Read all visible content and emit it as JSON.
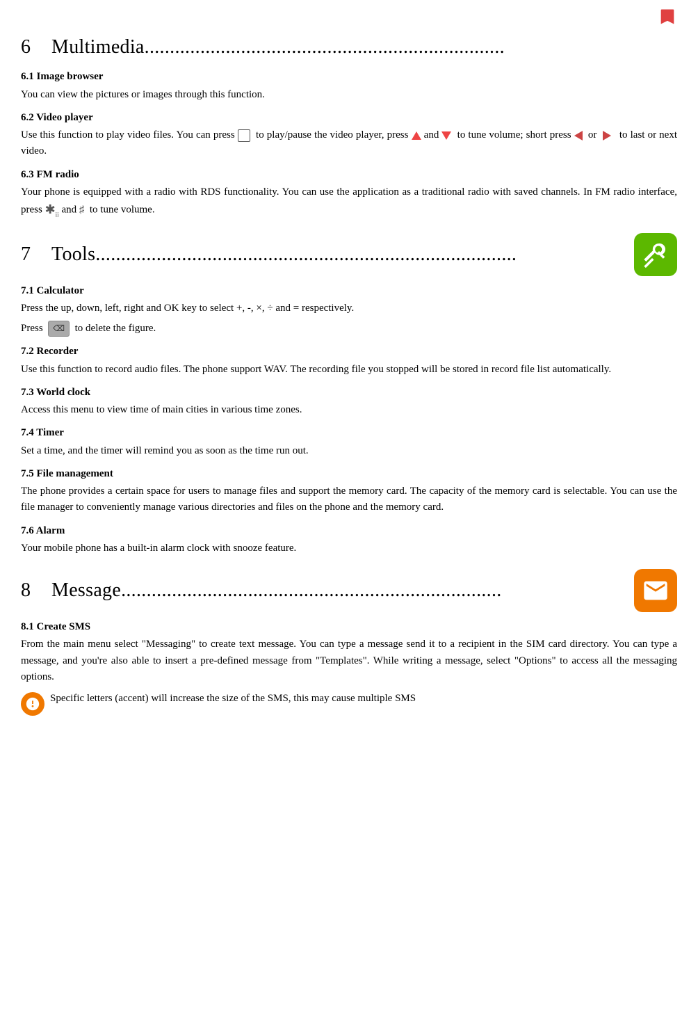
{
  "topIcon": "bookmark-icon",
  "sections": [
    {
      "number": "6",
      "title": "Multimedia.......................................................................",
      "iconType": "none",
      "subsections": [
        {
          "id": "6.1",
          "title": "6.1  Image browser",
          "body": [
            "You can view the pictures or images through this function."
          ]
        },
        {
          "id": "6.2",
          "title": "6.2   Video player",
          "body": [
            "Use this function to play video files. You can press [PLAY] to play/pause the video player, press [UP] and [DOWN] to tune volume; short press [LEFT] or [RIGHT] to last or next video."
          ]
        },
        {
          "id": "6.3",
          "title": "6.3  FM radio",
          "body": [
            "Your phone is equipped with a radio with RDS functionality. You can use the application as a traditional radio with saved channels. In FM radio interface, press [STAR] and [HASH] to tune volume."
          ]
        }
      ]
    },
    {
      "number": "7",
      "title": "Tools...................................................................................",
      "iconType": "green",
      "subsections": [
        {
          "id": "7.1",
          "title": "7.1  Calculator",
          "body": [
            "Press the up, down, left, right and OK key to select +, -, ×, ÷ and = respectively.",
            "Press [DELETE] to delete the figure."
          ]
        },
        {
          "id": "7.2",
          "title": "7.2  Recorder",
          "body": [
            "Use this function to record audio files. The phone support WAV. The recording file you stopped will be stored in record file list automatically."
          ]
        },
        {
          "id": "7.3",
          "title": "7.3  World clock",
          "body": [
            "Access this menu to view time of main cities in various time zones."
          ]
        },
        {
          "id": "7.4",
          "title": "7.4  Timer",
          "body": [
            "Set a time, and the timer will remind you as soon as the time run out."
          ]
        },
        {
          "id": "7.5",
          "title": "7.5  File management",
          "body": [
            "The phone provides a certain space for users to manage files and support the memory card. The capacity of the memory card is selectable. You can use the file manager to conveniently manage various directories and files on the phone and the memory card."
          ]
        },
        {
          "id": "7.6",
          "title": "7.6  Alarm",
          "body": [
            "Your mobile phone has a built-in alarm clock with snooze feature."
          ]
        }
      ]
    },
    {
      "number": "8",
      "title": "Message...........................................................................",
      "iconType": "orange",
      "subsections": [
        {
          "id": "8.1",
          "title": "8.1  Create SMS",
          "body": [
            "From the main menu select \"Messaging\" to create text message. You can type a message send it to a recipient in the SIM card directory. You can type a message, and you're also able to insert a pre-defined message from \"Templates\". While writing a message, select \"Options\" to access all the messaging options."
          ]
        }
      ]
    }
  ],
  "noteText": "Specific letters (accent) will increase the size of the SMS, this may cause multiple SMS"
}
